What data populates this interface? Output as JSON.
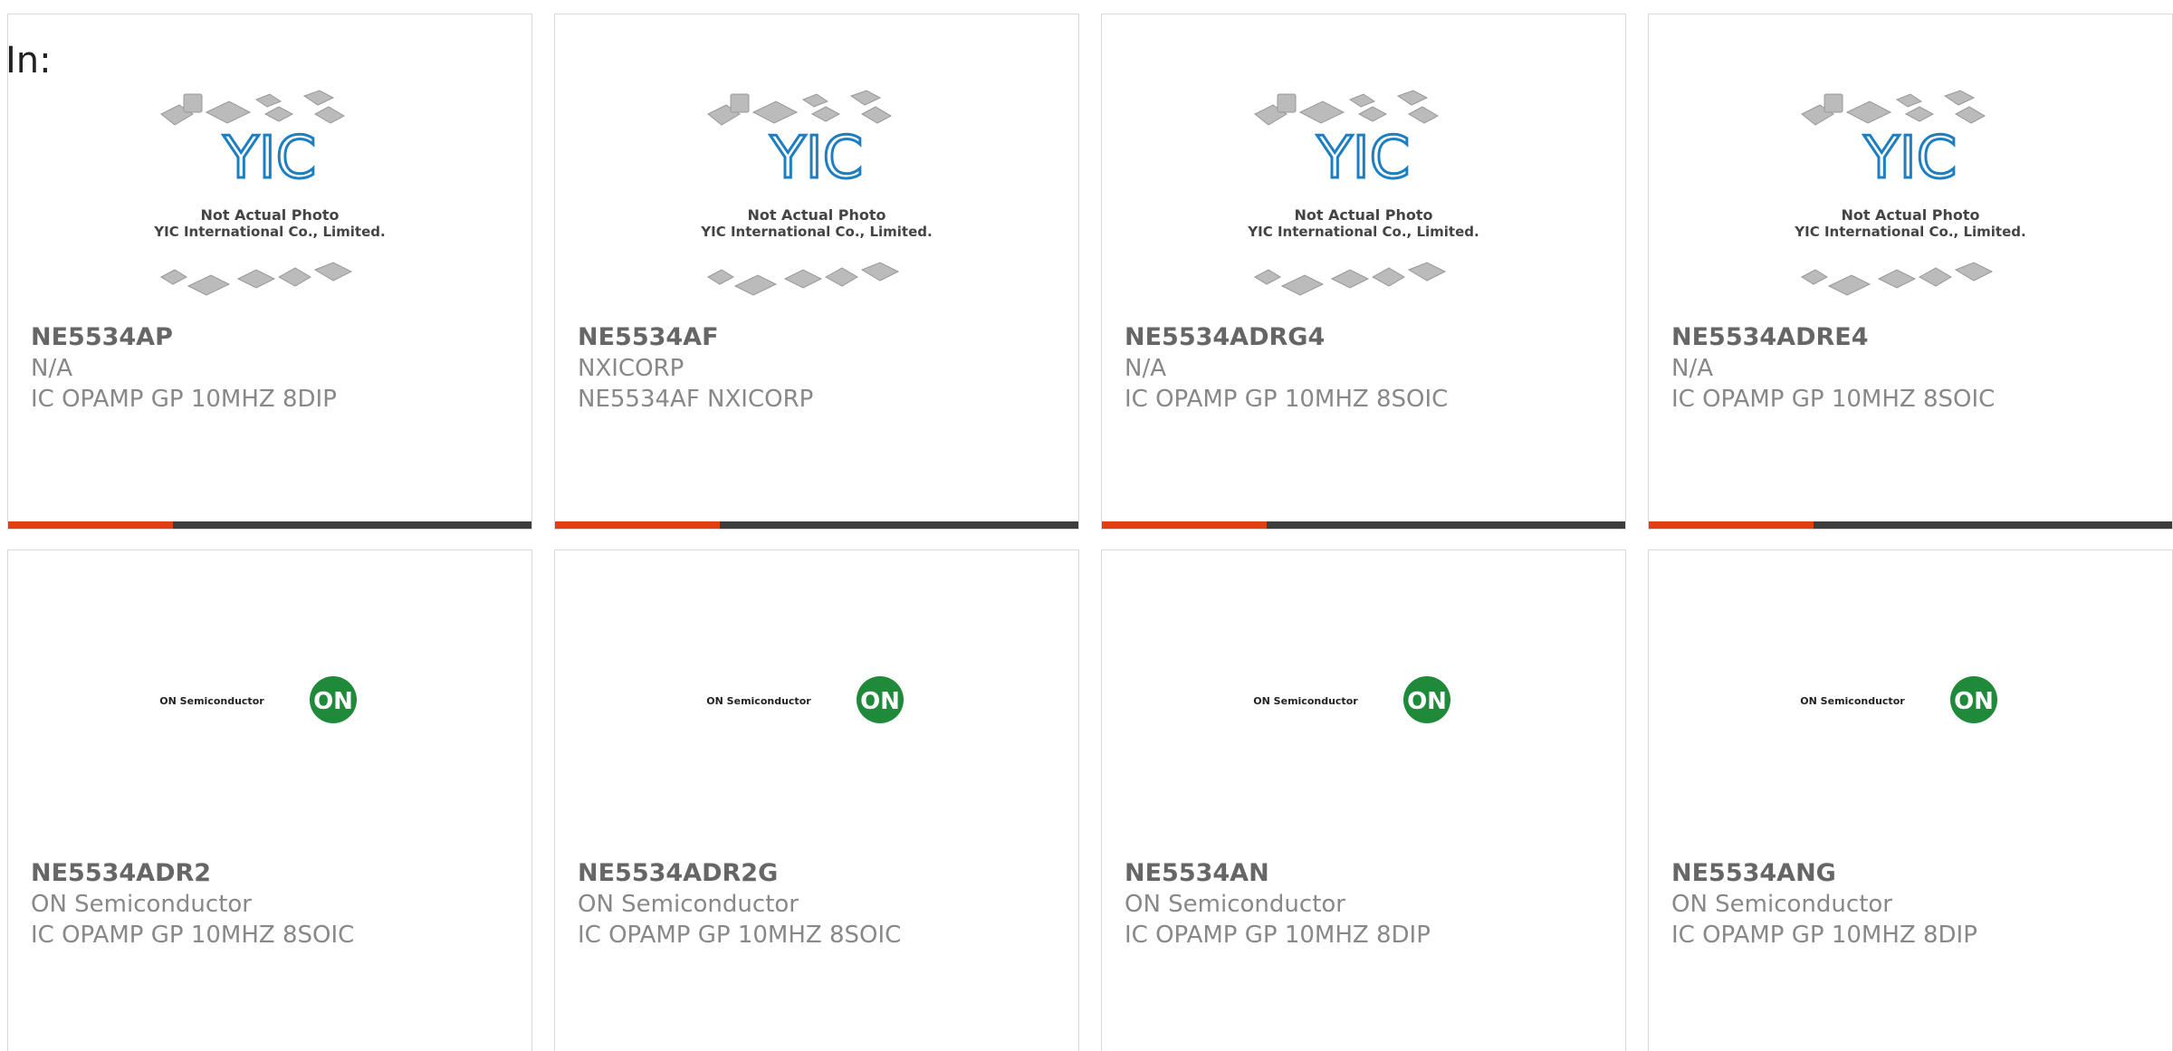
{
  "header": {
    "in_label": "In:"
  },
  "row1": [
    {
      "part": "NE5534AP",
      "mfr": "N/A",
      "desc": "IC OPAMP GP 10MHZ 8DIP"
    },
    {
      "part": "NE5534AF",
      "mfr": "NXICORP",
      "desc": "NE5534AF NXICORP"
    },
    {
      "part": "NE5534ADRG4",
      "mfr": "N/A",
      "desc": "IC OPAMP GP 10MHZ 8SOIC"
    },
    {
      "part": "NE5534ADRE4",
      "mfr": "N/A",
      "desc": "IC OPAMP GP 10MHZ 8SOIC"
    }
  ],
  "row2": [
    {
      "part": "NE5534ADR2",
      "mfr": "ON Semiconductor",
      "desc": "IC OPAMP GP 10MHZ 8SOIC"
    },
    {
      "part": "NE5534ADR2G",
      "mfr": "ON Semiconductor",
      "desc": "IC OPAMP GP 10MHZ 8SOIC"
    },
    {
      "part": "NE5534AN",
      "mfr": "ON Semiconductor",
      "desc": "IC OPAMP GP 10MHZ 8DIP"
    },
    {
      "part": "NE5534ANG",
      "mfr": "ON Semiconductor",
      "desc": "IC OPAMP GP 10MHZ 8DIP"
    }
  ],
  "placeholder": {
    "line1": "Not Actual Photo",
    "line2": "YIC International Co., Limited.",
    "logo": "YIC"
  },
  "on_logo": {
    "brand": "ON Semiconductor",
    "mark": "ON"
  },
  "colors": {
    "accent": "#e13e12",
    "bar": "#3d3d3d",
    "on_green": "#1f8a3a"
  }
}
